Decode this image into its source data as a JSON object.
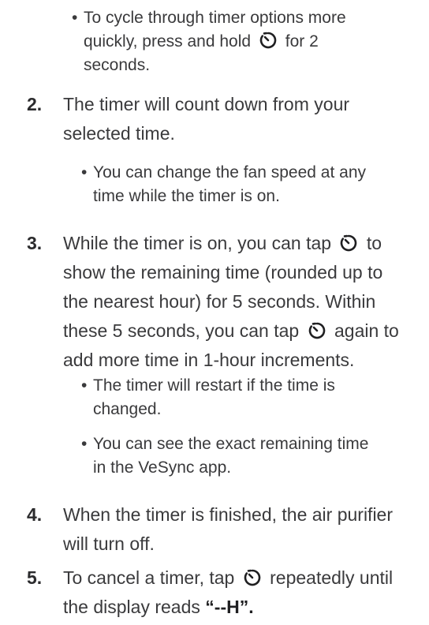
{
  "icon": "timer-icon",
  "bullet_top": {
    "part1": "To cycle through timer options more quickly, press and hold",
    "part2": "for 2 seconds."
  },
  "steps": [
    {
      "number": "2.",
      "text": "The timer will count down from your selected time.",
      "bullets": [
        "You can change the fan speed at any time while the timer is on."
      ]
    },
    {
      "number": "3.",
      "part1": "While the timer is on, you can tap",
      "part2": "to show the remaining time (rounded up to the nearest hour) for 5 seconds. Within these 5 seconds, you can tap",
      "part3": "again to add more time in 1-hour increments.",
      "bullets": [
        "The timer will restart if the time is changed.",
        "You can see the exact remaining time in the VeSync app."
      ]
    },
    {
      "number": "4.",
      "text": "When the timer is finished, the air purifier will turn off."
    },
    {
      "number": "5.",
      "part1": "To cancel a timer, tap",
      "part2": "repeatedly until the display reads",
      "bold": "“--H”."
    }
  ]
}
